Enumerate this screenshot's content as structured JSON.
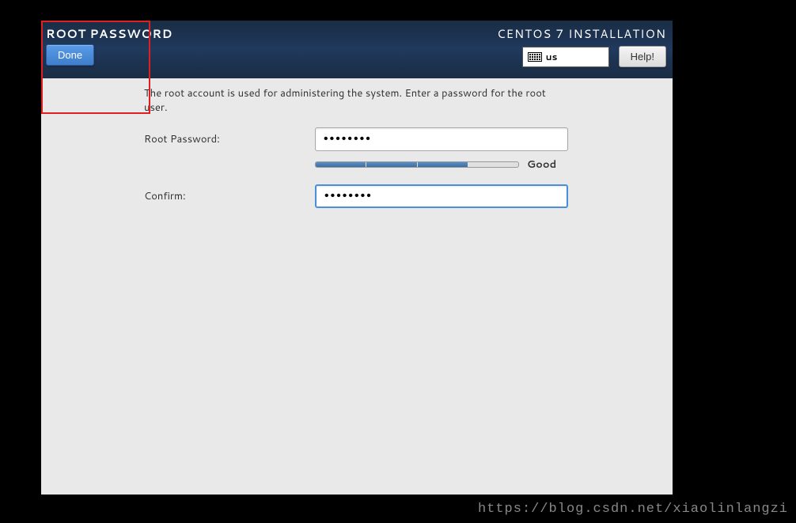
{
  "header": {
    "page_title": "ROOT PASSWORD",
    "done_label": "Done",
    "install_title": "CENTOS 7 INSTALLATION",
    "keyboard_layout": "us",
    "help_label": "Help!"
  },
  "content": {
    "description": "The root account is used for administering the system.  Enter a password for the root user.",
    "password_label": "Root Password:",
    "password_value": "••••••••",
    "confirm_label": "Confirm:",
    "confirm_value": "••••••••",
    "strength_label": "Good",
    "strength_segments_filled": 3,
    "strength_segments_total": 4
  },
  "watermark": "https://blog.csdn.net/xiaolinlangzi"
}
